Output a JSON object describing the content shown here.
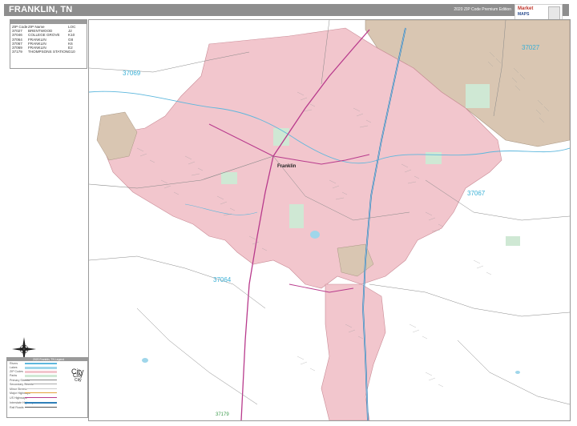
{
  "map": {
    "title": "FRANKLIN, TN",
    "edition": "2020 ZIP Code Premium Edition",
    "city_label": "Franklin",
    "zip_labels": [
      "37069",
      "37027",
      "37067",
      "37064",
      "37179"
    ],
    "colors": {
      "franklin_zip": "#f2c6cd",
      "brentwood_zip": "#d9c6b2",
      "park": "#cfe8d4",
      "water": "#9fd6ea",
      "interstate": "#2f7fb8",
      "highway": "#b83a8c",
      "title_bar": "#8e8e8e"
    }
  },
  "logo": {
    "brand_top": "Market",
    "brand_bottom": "MAPS"
  },
  "zip_table": {
    "headers": [
      "ZIP Code",
      "ZIP Name",
      "LOC"
    ],
    "rows": [
      [
        "37027",
        "BRENTWOOD",
        "J2"
      ],
      [
        "37046",
        "COLLEGE GROVE",
        "K10"
      ],
      [
        "37064",
        "FRANKLIN",
        "G8"
      ],
      [
        "37067",
        "FRANKLIN",
        "K6"
      ],
      [
        "37069",
        "FRANKLIN",
        "E2"
      ],
      [
        "37179",
        "THOMPSONS STATION",
        "G10"
      ]
    ]
  },
  "legend": {
    "title": "2020 Franklin, TN Legend",
    "city_big": "City",
    "city_mid": "City",
    "city_small": "City",
    "items": [
      "Rivers",
      "Lakes",
      "ZIP Codes",
      "Parks",
      "Primary Streets",
      "Secondary Streets",
      "Minor Streets",
      "Major Highways",
      "US Highways",
      "Interstate Highways",
      "Rail Roads"
    ]
  },
  "compass_icon": "compass-rose-icon"
}
